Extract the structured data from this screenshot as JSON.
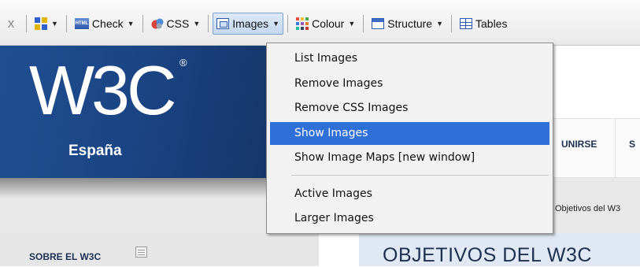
{
  "toolbar": {
    "close_glyph": "x",
    "buttons": [
      {
        "label": "",
        "icon": "options-grid-icon"
      },
      {
        "label": "Check",
        "icon": "html-icon"
      },
      {
        "label": "CSS",
        "icon": "css-icon"
      },
      {
        "label": "Images",
        "icon": "images-icon",
        "active": true
      },
      {
        "label": "Colour",
        "icon": "colour-icon"
      },
      {
        "label": "Structure",
        "icon": "structure-icon"
      },
      {
        "label": "Tables",
        "icon": "tables-icon"
      }
    ],
    "caret": "▼"
  },
  "images_menu": {
    "items": [
      {
        "label": "List Images"
      },
      {
        "label": "Remove Images"
      },
      {
        "label": "Remove CSS Images"
      },
      {
        "label": "Show Images",
        "selected": true
      },
      {
        "label": "Show Image Maps [new window]"
      },
      {
        "label": "Active Images"
      },
      {
        "label": "Larger Images"
      }
    ]
  },
  "page": {
    "logo_text": "W3C",
    "logo_registered": "®",
    "logo_subtitle": "España",
    "nav": {
      "item1": "UNIRSE",
      "item2": "S"
    },
    "breadcrumb": "Objetivos del W3",
    "sidebar_title": "SOBRE EL W3C",
    "content_title": "OBJETIVOS DEL W3C"
  },
  "colors": {
    "accent_selected": "#2f6fd8",
    "logo_blue": "#1a4382"
  }
}
